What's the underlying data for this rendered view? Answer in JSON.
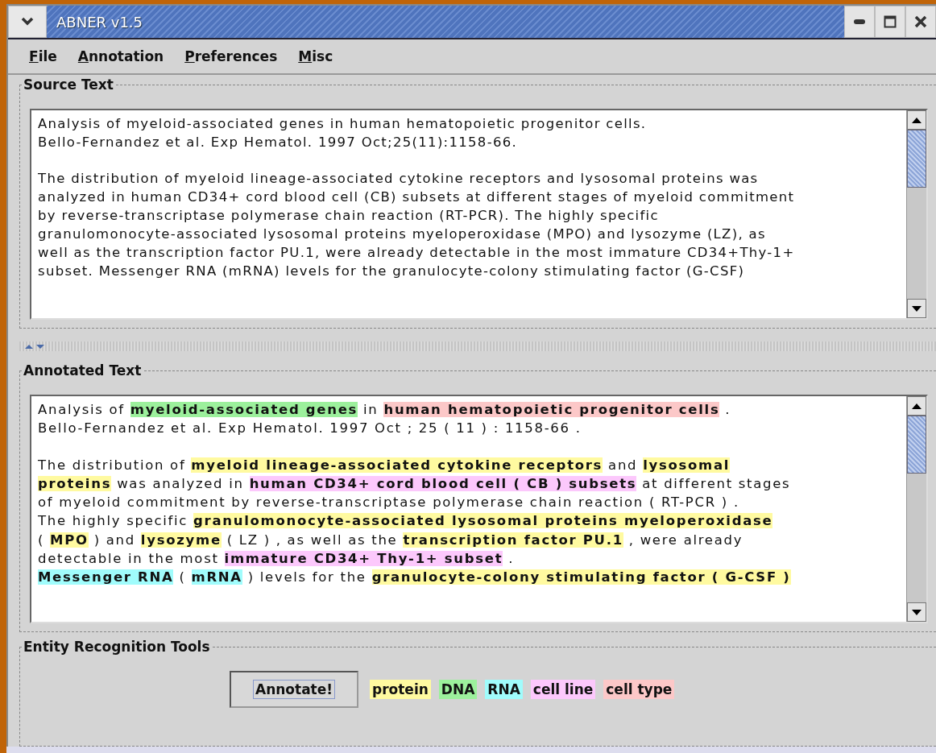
{
  "window": {
    "title": "ABNER v1.5"
  },
  "menu": [
    "File",
    "Annotation",
    "Preferences",
    "Misc"
  ],
  "source_text": {
    "title": "Source Text",
    "paragraphs": [
      [
        "Analysis of myeloid-associated genes in human hematopoietic progenitor cells.",
        "Bello-Fernandez et al. Exp Hematol.  1997 Oct;25(11):1158-66."
      ],
      [
        "The distribution of myeloid lineage-associated cytokine receptors and lysosomal proteins was",
        "analyzed in human CD34+ cord blood cell (CB) subsets at different stages of myeloid commitment",
        "by reverse-transcriptase polymerase chain reaction (RT-PCR). The highly specific",
        "granulomonocyte-associated lysosomal proteins myeloperoxidase (MPO) and lysozyme (LZ), as",
        "well as the transcription factor PU.1, were already detectable in the most immature CD34+Thy-1+",
        "subset. Messenger RNA (mRNA) levels for the granulocyte-colony stimulating factor (G-CSF)"
      ]
    ]
  },
  "annotated_text": {
    "title": "Annotated Text",
    "paragraphs": [
      [
        [
          {
            "text": "Analysis of ",
            "kind": "plain"
          },
          {
            "text": "myeloid-associated genes",
            "kind": "dna"
          },
          {
            "text": " in ",
            "kind": "plain"
          },
          {
            "text": "human hematopoietic progenitor cells",
            "kind": "cell_type"
          },
          {
            "text": " .",
            "kind": "plain"
          }
        ],
        [
          {
            "text": "Bello-Fernandez et al. Exp Hematol. 1997 Oct ; 25 ( 11 ) : 1158-66 .",
            "kind": "plain"
          }
        ]
      ],
      [
        [
          {
            "text": "The distribution of ",
            "kind": "plain"
          },
          {
            "text": "myeloid lineage-associated cytokine receptors",
            "kind": "protein"
          },
          {
            "text": " and ",
            "kind": "plain"
          },
          {
            "text": "lysosomal",
            "kind": "protein"
          }
        ],
        [
          {
            "text": "proteins",
            "kind": "protein"
          },
          {
            "text": " was analyzed in ",
            "kind": "plain"
          },
          {
            "text": "human CD34+ cord blood cell ( CB ) subsets",
            "kind": "cell_line"
          },
          {
            "text": " at different stages",
            "kind": "plain"
          }
        ],
        [
          {
            "text": "of myeloid commitment by reverse-transcriptase polymerase chain reaction ( RT-PCR ) .",
            "kind": "plain"
          }
        ],
        [
          {
            "text": "The highly specific ",
            "kind": "plain"
          },
          {
            "text": "granulomonocyte-associated lysosomal proteins myeloperoxidase",
            "kind": "protein"
          }
        ],
        [
          {
            "text": "( ",
            "kind": "plain"
          },
          {
            "text": "MPO",
            "kind": "protein"
          },
          {
            "text": " ) and ",
            "kind": "plain"
          },
          {
            "text": "lysozyme",
            "kind": "protein"
          },
          {
            "text": " ( LZ ) , as well as the ",
            "kind": "plain"
          },
          {
            "text": "transcription factor PU.1",
            "kind": "protein"
          },
          {
            "text": " , were already",
            "kind": "plain"
          }
        ],
        [
          {
            "text": "detectable in the most ",
            "kind": "plain"
          },
          {
            "text": "immature CD34+ Thy-1+ subset",
            "kind": "cell_line"
          },
          {
            "text": " .",
            "kind": "plain"
          }
        ],
        [
          {
            "text": "Messenger RNA",
            "kind": "rna"
          },
          {
            "text": " ( ",
            "kind": "plain"
          },
          {
            "text": "mRNA",
            "kind": "rna"
          },
          {
            "text": " ) levels for the ",
            "kind": "plain"
          },
          {
            "text": "granulocyte-colony stimulating factor ( G-CSF )",
            "kind": "protein"
          }
        ]
      ]
    ]
  },
  "tools": {
    "title": "Entity Recognition Tools",
    "button": "Annotate!",
    "legend": [
      {
        "label": "protein",
        "kind": "protein",
        "color": "#fffaa0"
      },
      {
        "label": "DNA",
        "kind": "dna",
        "color": "#9cf09c"
      },
      {
        "label": "RNA",
        "kind": "rna",
        "color": "#a0fcfc"
      },
      {
        "label": "cell line",
        "kind": "cell_line",
        "color": "#fcc8fc"
      },
      {
        "label": "cell type",
        "kind": "cell_type",
        "color": "#fcc8c8"
      }
    ]
  }
}
